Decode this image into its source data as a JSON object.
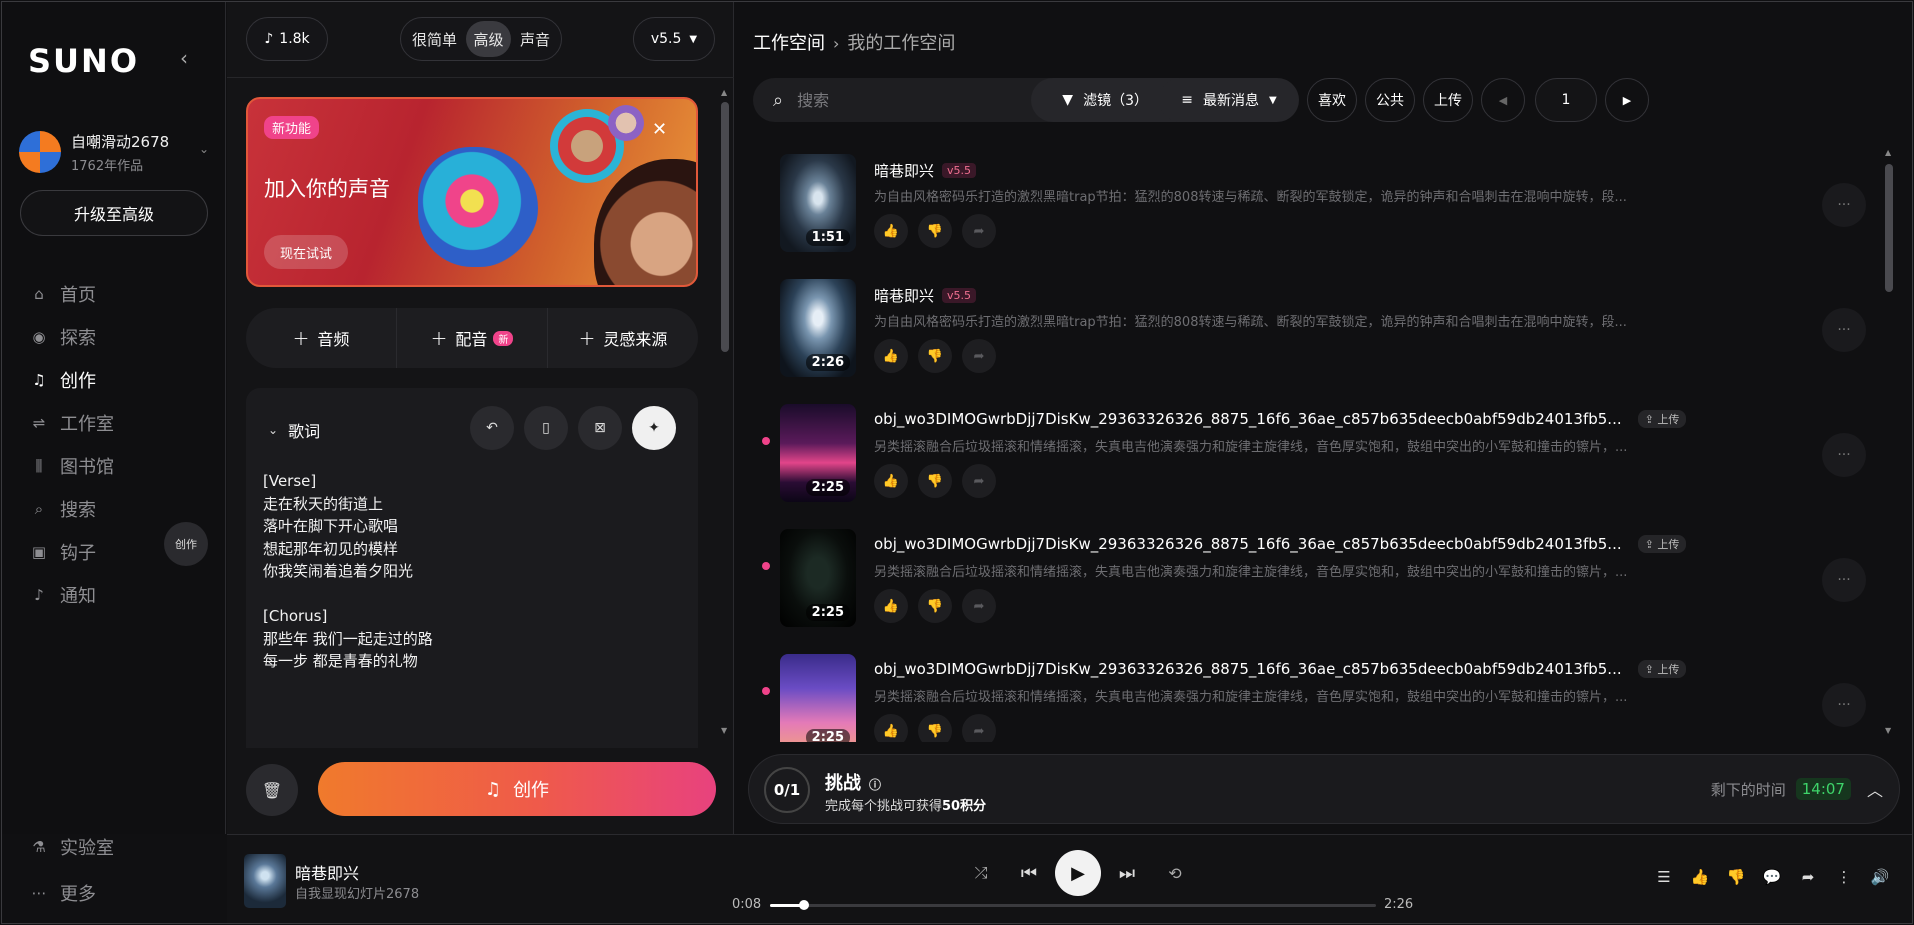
{
  "brand": "SUNO",
  "user": {
    "name": "自嘲滑动2678",
    "works": "1762年作品"
  },
  "upgrade_label": "升级至高级",
  "nav": [
    {
      "label": "首页",
      "icon": "home-icon",
      "glyph": "⌂"
    },
    {
      "label": "探索",
      "icon": "compass-icon",
      "glyph": "◉"
    },
    {
      "label": "创作",
      "icon": "music-note-icon",
      "glyph": "♫",
      "active": true
    },
    {
      "label": "工作室",
      "icon": "studio-icon",
      "glyph": "⇌"
    },
    {
      "label": "图书馆",
      "icon": "library-icon",
      "glyph": "⫼"
    },
    {
      "label": "搜索",
      "icon": "search-icon",
      "glyph": "⌕"
    },
    {
      "label": "钩子",
      "icon": "hook-icon",
      "glyph": "▣"
    },
    {
      "label": "通知",
      "icon": "bell-icon",
      "glyph": "♪"
    }
  ],
  "nav_create_button": "创作",
  "nav_bottom": [
    {
      "label": "实验室",
      "icon": "flask-icon",
      "glyph": "⚗"
    },
    {
      "label": "更多",
      "icon": "more-icon",
      "glyph": "⋯"
    }
  ],
  "panel": {
    "credits": "1.8k",
    "modes": [
      "很简单",
      "高级",
      "声音"
    ],
    "selected_mode": "高级",
    "version": "v5.5",
    "promo": {
      "badge": "新功能",
      "title": "加入你的声音",
      "cta": "现在试试"
    },
    "add_buttons": [
      {
        "label": "音频"
      },
      {
        "label": "配音",
        "badge": "新"
      },
      {
        "label": "灵感来源"
      }
    ],
    "lyrics_title": "歌词",
    "lyrics": "[Verse]\n走在秋天的街道上\n落叶在脚下开心歌唱\n想起那年初见的模样\n你我笑闹着追着夕阳光\n\n[Chorus]\n那些年 我们一起走过的路\n每一步 都是青春的礼物",
    "create_label": "创作"
  },
  "workspace": {
    "crumb_root": "工作空间",
    "crumb_current": "我的工作空间",
    "search_placeholder": "搜索",
    "filter_label": "滤镜（3）",
    "sort_label": "最新消息",
    "like_label": "喜欢",
    "public_label": "公共",
    "upload_label": "上传",
    "page": "1",
    "songs": [
      {
        "title": "暗巷即兴",
        "tag": "v5.5",
        "tag_type": "version",
        "duration": "1:51",
        "desc": "为自由风格密码乐打造的激烈黑暗trap节拍：猛烈的808转速与稀疏、断裂的军鼓锁定，诡异的钟声和合唱刺击在混响中旋转，段...",
        "dot": false,
        "art": "tunnel"
      },
      {
        "title": "暗巷即兴",
        "tag": "v5.5",
        "tag_type": "version",
        "duration": "2:26",
        "desc": "为自由风格密码乐打造的激烈黑暗trap节拍：猛烈的808转速与稀疏、断裂的军鼓锁定，诡异的钟声和合唱刺击在混响中旋转，段...",
        "dot": false,
        "art": "tunnel2"
      },
      {
        "title": "obj_wo3DIMOGwrbDjj7DisKw_29363326326_8875_16f6_36ae_c857b635deecb0abf59db24013fb5...",
        "tag": "上传",
        "tag_type": "upload",
        "duration": "2:25",
        "desc": "另类摇滚融合后垃圾摇滚和情绪摇滚，失真电吉他演奏强力和旋律主旋律线，音色厚实饱和，鼓组中突出的小军鼓和撞击的镲片，...",
        "dot": true,
        "art": "synth"
      },
      {
        "title": "obj_wo3DIMOGwrbDjj7DisKw_29363326326_8875_16f6_36ae_c857b635deecb0abf59db24013fb5...",
        "tag": "上传",
        "tag_type": "upload",
        "duration": "2:25",
        "desc": "另类摇滚融合后垃圾摇滚和情绪摇滚，失真电吉他演奏强力和旋律主旋律线，音色厚实饱和，鼓组中突出的小军鼓和撞击的镲片，...",
        "dot": true,
        "art": "dark"
      },
      {
        "title": "obj_wo3DIMOGwrbDjj7DisKw_29363326326_8875_16f6_36ae_c857b635deecb0abf59db24013fb5...",
        "tag": "上传",
        "tag_type": "upload",
        "duration": "2:25",
        "desc": "另类摇滚融合后垃圾摇滚和情绪摇滚，失真电吉他演奏强力和旋律主旋律线，音色厚实饱和，鼓组中突出的小军鼓和撞击的镲片，...",
        "dot": true,
        "art": "tower"
      }
    ],
    "challenge": {
      "count": "0/1",
      "title": "挑战",
      "sub_prefix": "完成每个挑战可获得",
      "sub_reward": "50积分",
      "remaining_label": "剩下的时间",
      "timer": "14:07"
    }
  },
  "player": {
    "title": "暗巷即兴",
    "artist": "自我显现幻灯片2678",
    "elapsed": "0:08",
    "total": "2:26",
    "progress": 0.0548
  },
  "colors": {
    "accent_pink": "#f0438a",
    "timer_green": "#3ed46a"
  }
}
